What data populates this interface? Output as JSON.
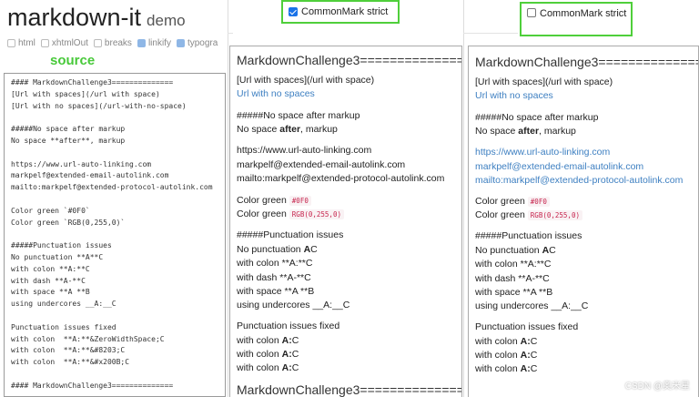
{
  "app": {
    "title": "markdown-it",
    "subtitle": "demo"
  },
  "options": [
    {
      "label": "html",
      "checked": false
    },
    {
      "label": "xhtmlOut",
      "checked": false
    },
    {
      "label": "breaks",
      "checked": false
    },
    {
      "label": "linkify",
      "checked": true
    },
    {
      "label": "typogra",
      "checked": true
    }
  ],
  "source_label": "source",
  "source_lines": [
    "#### MarkdownChallenge3==============",
    "[Url with spaces](/url with space)",
    "[Url with no spaces](/url-with-no-space)",
    "",
    "#####No space after markup",
    "No space **after**, markup",
    "",
    "https://www.url-auto-linking.com",
    "markpelf@extended-email-autolink.com",
    "mailto:markpelf@extended-protocol-autolink.com",
    "",
    "Color green `#0F0`",
    "Color green `RGB(0,255,0)`",
    "",
    "#####Punctuation issues",
    "No punctuation **A**C",
    "with colon **A:**C",
    "with dash **A-**C",
    "with space **A **B",
    "using undercores __A:__C",
    "",
    "Punctuation issues fixed",
    "with colon  **A:**&ZeroWidthSpace;C",
    "with colon  **A:**&#8203;C",
    "with colon  **A:**&#x200B;C",
    "",
    "#### MarkdownChallenge3=============="
  ],
  "strict_mid": {
    "label": "CommonMark strict",
    "checked": true
  },
  "strict_right": {
    "label": "CommonMark strict",
    "checked": false
  },
  "preview_mid": {
    "heading": "MarkdownChallenge3==============",
    "url_spaces": "[Url with spaces](/url with space)",
    "url_no_spaces": "Url with no spaces",
    "h_nospace": "#####No space after markup",
    "nospace_pre": "No space ",
    "nospace_bold": "after",
    "nospace_post": ", markup",
    "autolink1": "https://www.url-auto-linking.com",
    "autolink2": "markpelf@extended-email-autolink.com",
    "autolink3": "mailto:markpelf@extended-protocol-autolink.com",
    "color_label": "Color green",
    "color_code1": "#0F0",
    "color_code2": "RGB(0,255,0)",
    "h_punct": "#####Punctuation issues",
    "punct_no_pre": "No punctuation ",
    "punct_no_bold": "A",
    "punct_no_post": "C",
    "punct_colon": "with colon **A:**C",
    "punct_dash": "with dash **A-**C",
    "punct_space": "with space **A **B",
    "punct_under": "using undercores __A:__C",
    "fixed_title": "Punctuation issues fixed",
    "fixed_pre": "with colon ",
    "fixed_bold": "A:",
    "fixed_post": "C",
    "heading2": "MarkdownChallenge3=============="
  },
  "preview_right": {
    "heading": "MarkdownChallenge3==============",
    "url_spaces": "[Url with spaces](/url with space)",
    "url_no_spaces": "Url with no spaces",
    "h_nospace": "#####No space after markup",
    "nospace_pre": "No space ",
    "nospace_bold": "after",
    "nospace_post": ", markup",
    "autolink1": "https://www.url-auto-linking.com",
    "autolink2": "markpelf@extended-email-autolink.com",
    "autolink3": "mailto:markpelf@extended-protocol-autolink.com",
    "color_label": "Color green",
    "color_code1": "#0F0",
    "color_code2": "RGB(0,255,0)",
    "h_punct": "#####Punctuation issues",
    "punct_no_pre": "No punctuation ",
    "punct_no_bold": "A",
    "punct_no_post": "C",
    "punct_colon": "with colon **A:**C",
    "punct_dash": "with dash **A-**C",
    "punct_space": "with space **A **B",
    "punct_under": "using undercores __A:__C",
    "fixed_title": "Punctuation issues fixed",
    "fixed_pre": "with colon ",
    "fixed_bold": "A:",
    "fixed_post": "C"
  },
  "watermark": "CSDN @奥米星",
  "colors": {
    "highlight_green": "#4fcf3b",
    "source_green": "#48c93a",
    "link_blue": "#3d7fc1"
  }
}
